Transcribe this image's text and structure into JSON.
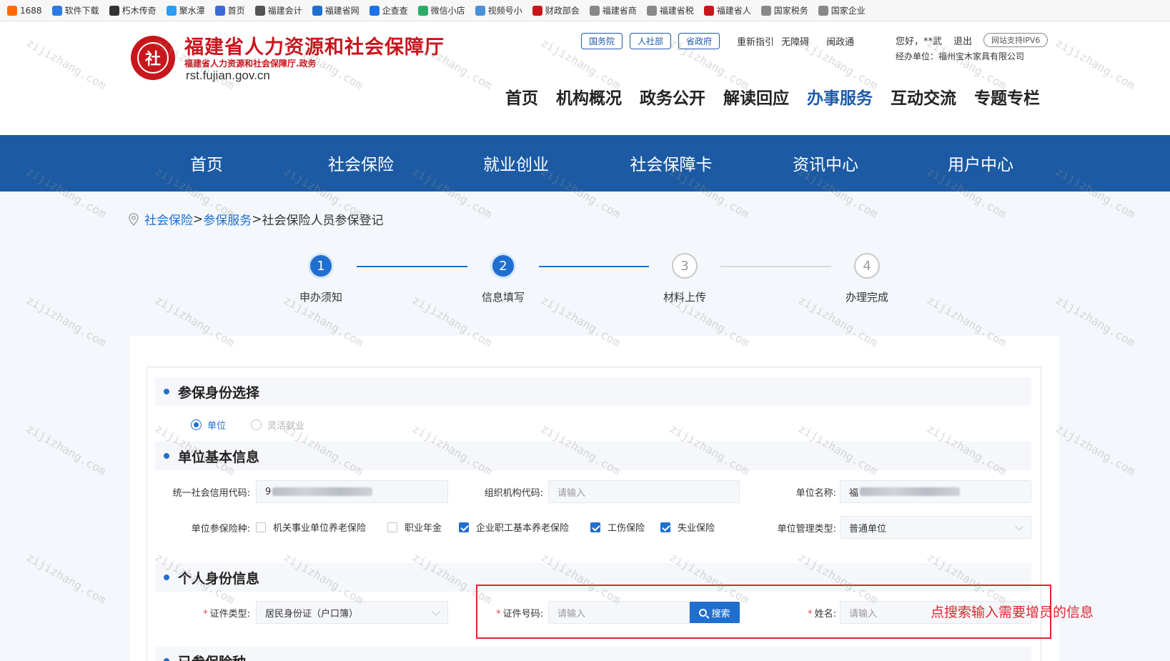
{
  "bookmarks": [
    {
      "label": "1688",
      "icon": "1688-icon",
      "color": "#ff6a00"
    },
    {
      "label": "软件下载",
      "icon": "globe-icon",
      "color": "#2a7ae2"
    },
    {
      "label": "朽木传奇",
      "icon": "puzzle-icon",
      "color": "#333333"
    },
    {
      "label": "聚水潭",
      "icon": "drop-icon",
      "color": "#2a9df4"
    },
    {
      "label": "首页",
      "icon": "page-icon",
      "color": "#3b6bd6"
    },
    {
      "label": "福建会计",
      "icon": "chart-icon",
      "color": "#555555"
    },
    {
      "label": "福建省网",
      "icon": "gear-icon",
      "color": "#1f6fd0"
    },
    {
      "label": "企查查",
      "icon": "qcc-icon",
      "color": "#1a73e8"
    },
    {
      "label": "微信小店",
      "icon": "wechat-icon",
      "color": "#2aae67"
    },
    {
      "label": "视频号小",
      "icon": "video-icon",
      "color": "#4a90d9"
    },
    {
      "label": "财政部会",
      "icon": "emblem-icon",
      "color": "#c8161d"
    },
    {
      "label": "福建省商",
      "icon": "globe-icon",
      "color": "#888888"
    },
    {
      "label": "福建省税",
      "icon": "globe-icon",
      "color": "#888888"
    },
    {
      "label": "福建省人",
      "icon": "emblem-icon",
      "color": "#c8161d"
    },
    {
      "label": "国家税务",
      "icon": "globe-icon",
      "color": "#888888"
    },
    {
      "label": "国家企业",
      "icon": "globe-icon",
      "color": "#888888"
    }
  ],
  "header": {
    "title": "福建省人力资源和社会保障厅",
    "subtitle": "福建省人力资源和社会保障厅.政务",
    "url": "rst.fujian.gov.cn",
    "seal_char": "社",
    "tags": [
      "国务院",
      "人社部",
      "省政府"
    ],
    "links": [
      "重新指引",
      "无障碍",
      "闽政通"
    ],
    "greeting": "您好，**武",
    "logout": "退出",
    "ipv6": "网站支持IPV6",
    "org_line": "经办单位：福州宝木家具有限公司",
    "main_nav": [
      "首页",
      "机构概况",
      "政务公开",
      "解读回应",
      "办事服务",
      "互动交流",
      "专题专栏"
    ],
    "main_nav_active": 4
  },
  "blue_nav": [
    "首页",
    "社会保险",
    "就业创业",
    "社会保障卡",
    "资讯中心",
    "用户中心"
  ],
  "breadcrumb": {
    "link1": "社会保险",
    "sep": ">",
    "link2": "参保服务",
    "current": "社会保险人员参保登记"
  },
  "steps": [
    {
      "num": "1",
      "label": "申办须知",
      "done": true
    },
    {
      "num": "2",
      "label": "信息填写",
      "done": true
    },
    {
      "num": "3",
      "label": "材料上传",
      "done": false
    },
    {
      "num": "4",
      "label": "办理完成",
      "done": false
    }
  ],
  "sections": {
    "identity": "参保身份选择",
    "unit": "单位基本信息",
    "person": "个人身份信息",
    "insured": "已参保险种"
  },
  "identity_options": {
    "unit": "单位",
    "flexible": "灵活就业"
  },
  "unit_info": {
    "credit_code_label": "统一社会信用代码:",
    "org_code_label": "组织机构代码:",
    "org_code_placeholder": "请输入",
    "unit_name_label": "单位名称:",
    "unit_name_prefix": "福",
    "credit_code_prefix": "9",
    "insurance_label": "单位参保险种:",
    "insurance_types": [
      {
        "label": "机关事业单位养老保险",
        "checked": false
      },
      {
        "label": "职业年金",
        "checked": false
      },
      {
        "label": "企业职工基本养老保险",
        "checked": true
      },
      {
        "label": "工伤保险",
        "checked": true
      },
      {
        "label": "失业保险",
        "checked": true
      }
    ],
    "mgmt_type_label": "单位管理类型:",
    "mgmt_type_value": "普通单位"
  },
  "person_info": {
    "cert_type_label": "证件类型:",
    "cert_type_value": "居民身份证（户口簿）",
    "cert_no_label": "证件号码:",
    "cert_no_placeholder": "请输入",
    "search_label": "搜索",
    "name_label": "姓名:",
    "name_placeholder": "请输入",
    "required_mark": "*"
  },
  "annotation": "点搜索输入需要增员的信息",
  "watermark": "zijizhang.com",
  "colors": {
    "brand_red": "#c8161d",
    "nav_blue": "#1c5aa3",
    "accent": "#1f6fd0",
    "annot_red": "#e0262e"
  }
}
